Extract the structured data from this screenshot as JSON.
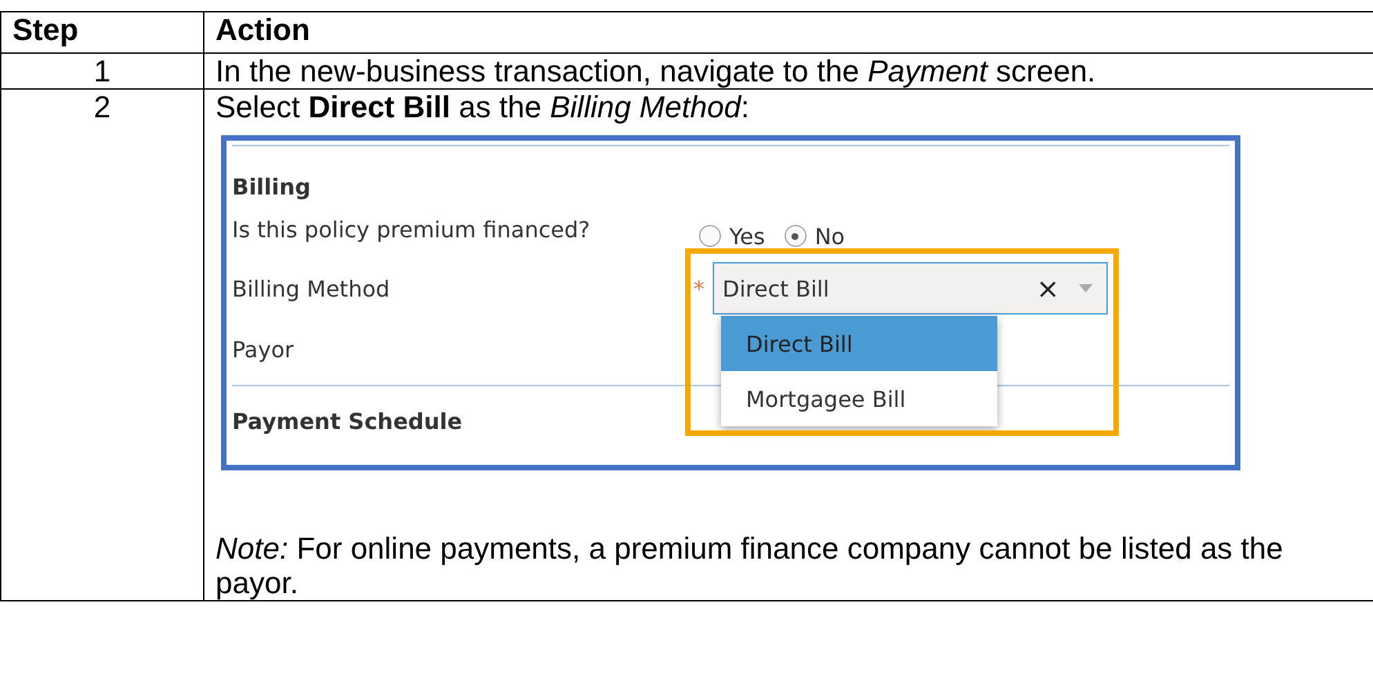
{
  "table": {
    "columns": [
      "Step",
      "Action"
    ],
    "rows": [
      {
        "step": "1",
        "action": "In the new-business transaction, navigate to the *Payment* screen."
      },
      {
        "step": "2",
        "action": "Select **Direct Bill** as the *Billing Method*:",
        "screenshot": {
          "highlighted": true,
          "section_title": "Billing",
          "fields": [
            {
              "kind": "radio",
              "label": "Is this policy premium financed?",
              "options": [
                {
                  "label": "Yes",
                  "selected": false
                },
                {
                  "label": "No",
                  "selected": true
                }
              ]
            },
            {
              "kind": "select",
              "label": "Billing Method",
              "required_mark": "*",
              "value": "Direct Bill",
              "clear": "×",
              "expanded": true,
              "options": [
                {
                  "label": "Direct Bill",
                  "selected": true
                },
                {
                  "label": "Mortgagee Bill",
                  "selected": false
                }
              ]
            },
            {
              "kind": "empty",
              "label": "Payor"
            }
          ],
          "next_section_title": "Payment Schedule"
        },
        "note": "*Note:* For online payments, a premium finance company cannot be listed as the payor."
      }
    ]
  }
}
